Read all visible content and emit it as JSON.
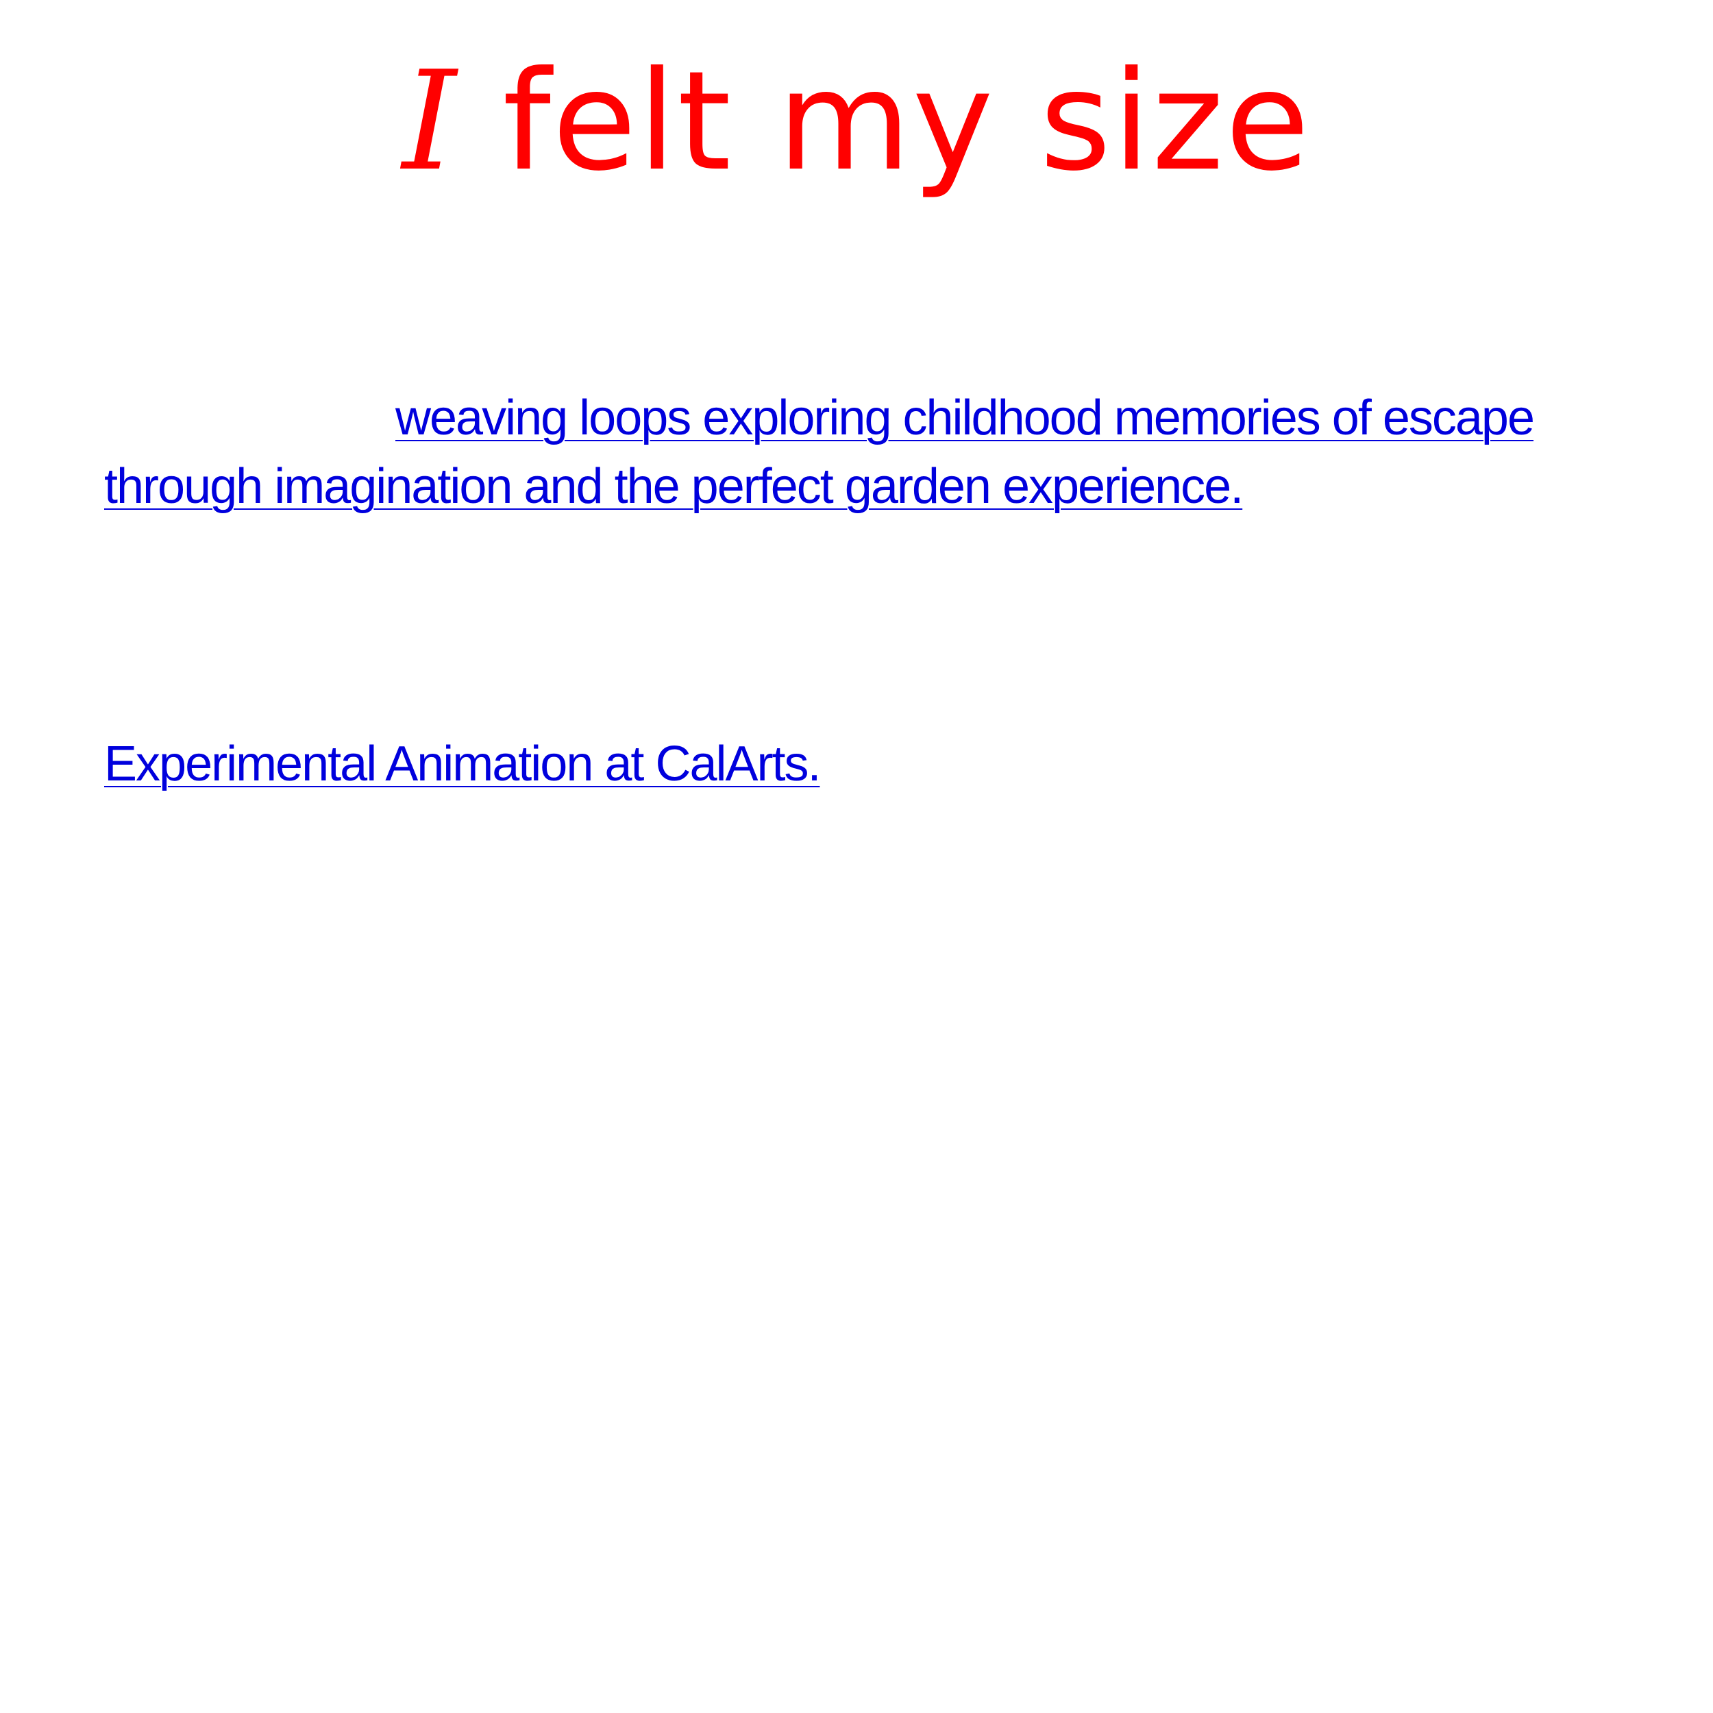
{
  "colors": {
    "title": "#ff0000",
    "link": "#0000dd",
    "background": "#ffffff"
  },
  "title": {
    "initial": "I",
    "rest": " felt my size"
  },
  "description": {
    "text": "weaving loops exploring childhood memories of escape through imagination and the perfect garden experience."
  },
  "credit": {
    "text": "Experimental Animation at CalArts."
  }
}
